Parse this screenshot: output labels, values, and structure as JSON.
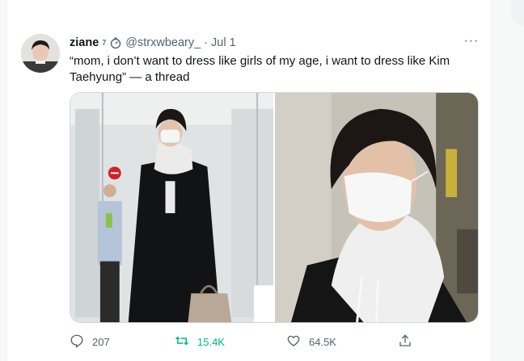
{
  "tweet": {
    "display_name": "ziane",
    "name_superscript": "7",
    "badge_icon": "stopwatch-icon",
    "handle": "@strxwbeary_",
    "separator": "·",
    "date": "Jul 1",
    "more_icon": "more-icon",
    "more_label": "···",
    "text": "“mom, i don’t want to dress like girls of my age, i want to dress like Kim Taehyung” — a thread"
  },
  "media": {
    "photos": [
      {
        "subject": "photo-airport-full-body"
      },
      {
        "subject": "photo-closeup-mask"
      }
    ]
  },
  "actions": {
    "reply": {
      "icon": "reply-icon",
      "count": "207"
    },
    "retweet": {
      "icon": "retweet-icon",
      "count": "15.4K",
      "color": "#00ba7c"
    },
    "like": {
      "icon": "heart-icon",
      "count": "64.5K"
    },
    "share": {
      "icon": "share-icon"
    }
  },
  "colors": {
    "text": "#0f1419",
    "secondary": "#536471",
    "retweet_active": "#00ba7c",
    "border": "#cfd9de"
  }
}
